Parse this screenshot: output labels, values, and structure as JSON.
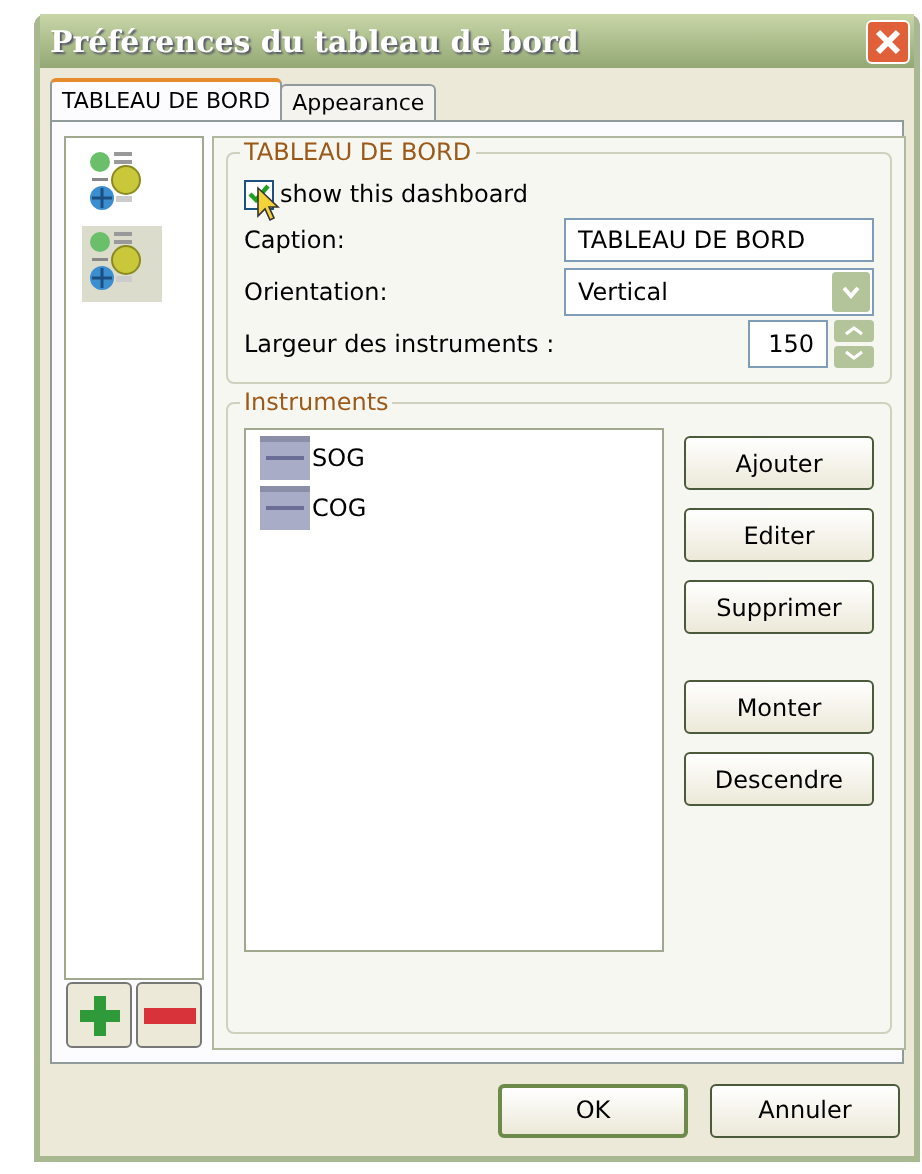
{
  "window": {
    "title": "Préférences du tableau de bord"
  },
  "tabs": [
    {
      "label": "TABLEAU DE BORD",
      "selected": true
    },
    {
      "label": "Appearance",
      "selected": false
    }
  ],
  "dashboards": [
    {
      "selected": false
    },
    {
      "selected": true
    }
  ],
  "dashboard_group": {
    "title": "TABLEAU DE BORD",
    "show": {
      "label": "show this dashboard",
      "checked": true
    },
    "caption": {
      "label": "Caption:",
      "value": "TABLEAU DE BORD"
    },
    "orientation": {
      "label": "Orientation:",
      "value": "Vertical"
    },
    "width": {
      "label": "Largeur des instruments :",
      "value": "150"
    }
  },
  "instruments_group": {
    "title": "Instruments",
    "items": [
      {
        "label": "SOG"
      },
      {
        "label": "COG"
      }
    ],
    "button_groups": [
      [
        "Ajouter",
        "Editer",
        "Supprimer"
      ],
      [
        "Monter",
        "Descendre"
      ]
    ]
  },
  "footer_buttons": [
    {
      "label": "OK",
      "default": true
    },
    {
      "label": "Annuler",
      "default": false
    }
  ]
}
